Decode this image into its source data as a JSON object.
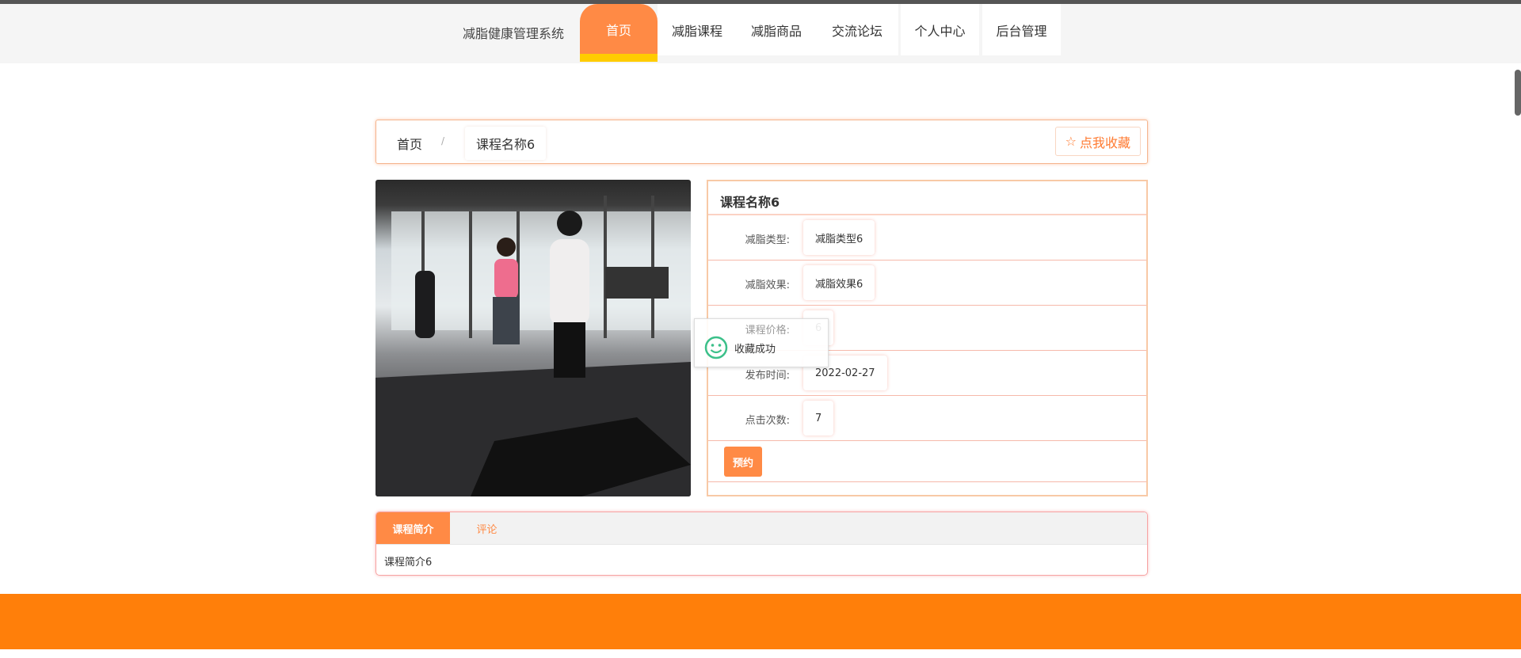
{
  "nav": {
    "brand": "减脂健康管理系统",
    "items": [
      "首页",
      "减脂课程",
      "减脂商品",
      "交流论坛",
      "个人中心",
      "后台管理"
    ]
  },
  "breadcrumb": {
    "home": "首页",
    "sep": "/",
    "current": "课程名称6",
    "favorite": "点我收藏"
  },
  "detail": {
    "title": "课程名称6",
    "rows": [
      {
        "label": "减脂类型:",
        "value": "减脂类型6"
      },
      {
        "label": "减脂效果:",
        "value": "减脂效果6"
      },
      {
        "label": "课程价格:",
        "value": "6"
      },
      {
        "label": "发布时间:",
        "value": "2022-02-27"
      },
      {
        "label": "点击次数:",
        "value": "7"
      }
    ],
    "book": "预约"
  },
  "toast": "收藏成功",
  "tabs": {
    "items": [
      "课程简介",
      "评论"
    ],
    "content": "课程简介6"
  },
  "colors": {
    "accent": "#ff8a45",
    "footer": "#ff7f0a",
    "highlight": "#ffcc00"
  }
}
